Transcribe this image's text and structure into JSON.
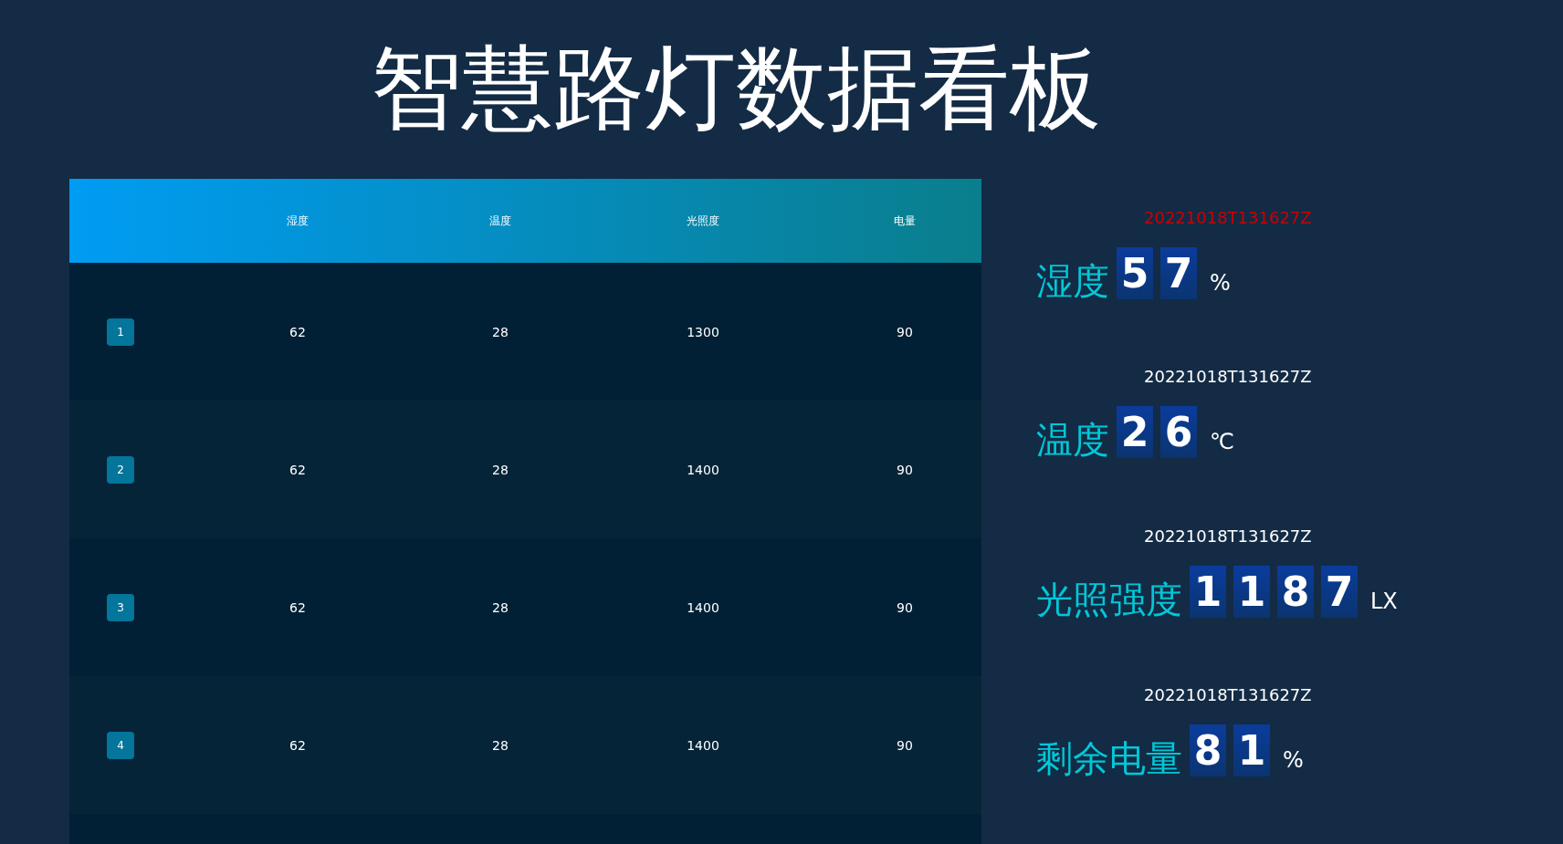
{
  "title": "智慧路灯数据看板",
  "table": {
    "columns": [
      "湿度",
      "温度",
      "光照度",
      "电量"
    ],
    "rows": [
      {
        "index": "1",
        "cells": [
          "62",
          "28",
          "1300",
          "90"
        ]
      },
      {
        "index": "2",
        "cells": [
          "62",
          "28",
          "1400",
          "90"
        ]
      },
      {
        "index": "3",
        "cells": [
          "62",
          "28",
          "1400",
          "90"
        ]
      },
      {
        "index": "4",
        "cells": [
          "62",
          "28",
          "1400",
          "90"
        ]
      }
    ]
  },
  "metrics": [
    {
      "timestamp": "20221018T131627Z",
      "color": "#cc0000",
      "label": "湿度",
      "digits": [
        "5",
        "7"
      ],
      "unit": "%"
    },
    {
      "timestamp": "20221018T131627Z",
      "color": "#ffffff",
      "label": "温度",
      "digits": [
        "2",
        "6"
      ],
      "unit": "℃"
    },
    {
      "timestamp": "20221018T131627Z",
      "color": "#ffffff",
      "label": "光照强度",
      "digits": [
        "1",
        "1",
        "8",
        "7"
      ],
      "unit": "LX"
    },
    {
      "timestamp": "20221018T131627Z",
      "color": "#ffffff",
      "label": "剩余电量",
      "digits": [
        "8",
        "1"
      ],
      "unit": "%"
    }
  ]
}
